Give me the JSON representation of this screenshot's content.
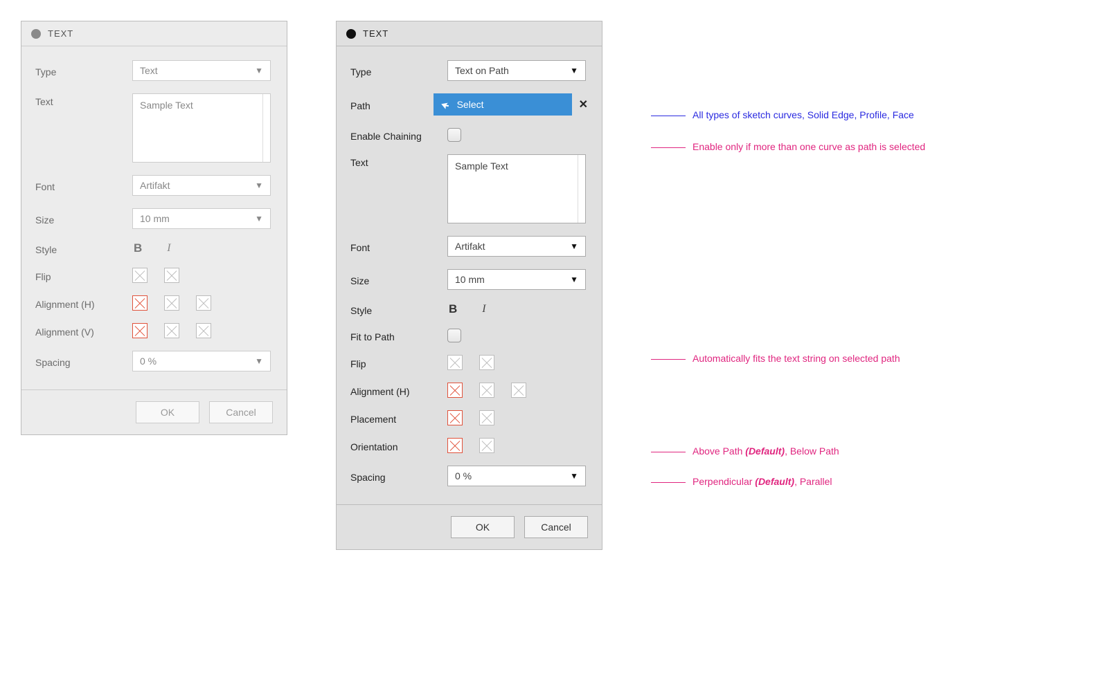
{
  "left": {
    "title": "TEXT",
    "type": {
      "label": "Type",
      "value": "Text"
    },
    "text": {
      "label": "Text",
      "value": "Sample Text"
    },
    "font": {
      "label": "Font",
      "value": "Artifakt"
    },
    "size": {
      "label": "Size",
      "value": "10 mm"
    },
    "style": {
      "label": "Style",
      "bold": "B",
      "italic": "I"
    },
    "flip": {
      "label": "Flip"
    },
    "alignH": {
      "label": "Alignment (H)"
    },
    "alignV": {
      "label": "Alignment (V)"
    },
    "spacing": {
      "label": "Spacing",
      "value": "0 %"
    },
    "ok": "OK",
    "cancel": "Cancel"
  },
  "right": {
    "title": "TEXT",
    "type": {
      "label": "Type",
      "value": "Text on Path"
    },
    "path": {
      "label": "Path",
      "button": "Select"
    },
    "chaining": {
      "label": "Enable Chaining"
    },
    "text": {
      "label": "Text",
      "value": "Sample Text"
    },
    "font": {
      "label": "Font",
      "value": "Artifakt"
    },
    "size": {
      "label": "Size",
      "value": "10 mm"
    },
    "style": {
      "label": "Style",
      "bold": "B",
      "italic": "I"
    },
    "fit": {
      "label": "Fit to Path"
    },
    "flip": {
      "label": "Flip"
    },
    "alignH": {
      "label": "Alignment (H)"
    },
    "placement": {
      "label": "Placement"
    },
    "orientation": {
      "label": "Orientation"
    },
    "spacing": {
      "label": "Spacing",
      "value": "0 %"
    },
    "ok": "OK",
    "cancel": "Cancel"
  },
  "annotations": {
    "path": "All types of sketch curves, Solid Edge, Profile, Face",
    "chaining": "Enable only if more than one curve as path is selected",
    "fit": "Automatically fits the text string on selected path",
    "placement_pre": "Above Path ",
    "placement_def": "(Default)",
    "placement_post": ", Below Path",
    "orientation_pre": "Perpendicular ",
    "orientation_def": "(Default)",
    "orientation_post": ", Parallel"
  }
}
